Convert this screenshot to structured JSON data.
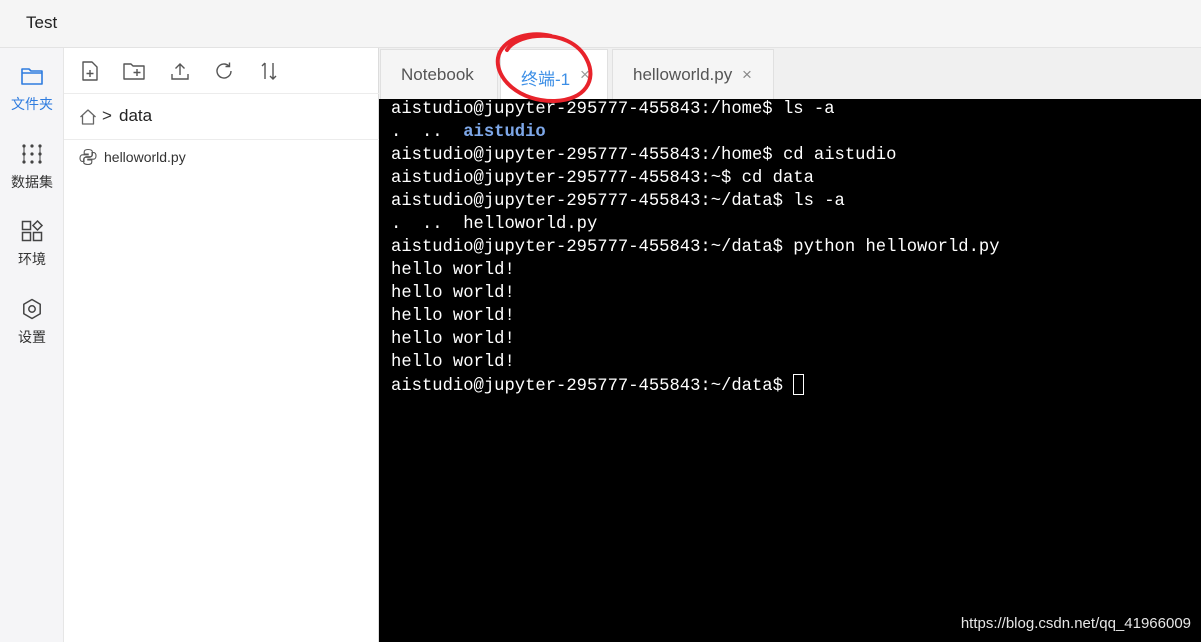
{
  "window": {
    "title": "Test"
  },
  "activity_bar": {
    "items": [
      {
        "label": "文件夹",
        "icon": "folder-icon",
        "active": true
      },
      {
        "label": "数据集",
        "icon": "dataset-icon",
        "active": false
      },
      {
        "label": "环境",
        "icon": "environment-icon",
        "active": false
      },
      {
        "label": "设置",
        "icon": "settings-icon",
        "active": false
      }
    ]
  },
  "file_toolbar": {
    "buttons": [
      "new-file-icon",
      "new-folder-icon",
      "upload-icon",
      "refresh-icon",
      "sort-icon"
    ]
  },
  "breadcrumb": {
    "separator": ">",
    "current": "data"
  },
  "files": [
    {
      "name": "helloworld.py",
      "icon": "python-icon"
    }
  ],
  "tabs": [
    {
      "label": "Notebook",
      "close": "",
      "active": false
    },
    {
      "label": "终端-1",
      "close": "×",
      "active": true
    },
    {
      "label": "helloworld.py",
      "close": "×",
      "active": false
    }
  ],
  "terminal": {
    "lines": [
      {
        "text": "aistudio@jupyter-295777-455843:/home$ ls -a"
      },
      {
        "pre": ".  ..  ",
        "dir": "aistudio"
      },
      {
        "text": "aistudio@jupyter-295777-455843:/home$ cd aistudio"
      },
      {
        "text": "aistudio@jupyter-295777-455843:~$ cd data"
      },
      {
        "text": "aistudio@jupyter-295777-455843:~/data$ ls -a"
      },
      {
        "text": ".  ..  helloworld.py"
      },
      {
        "text": "aistudio@jupyter-295777-455843:~/data$ python helloworld.py"
      },
      {
        "text": "hello world!"
      },
      {
        "text": "hello world!"
      },
      {
        "text": "hello world!"
      },
      {
        "text": "hello world!"
      },
      {
        "text": "hello world!"
      }
    ],
    "prompt": "aistudio@jupyter-295777-455843:~/data$ "
  },
  "colors": {
    "accent": "#2f7cdf",
    "active_tab_text": "#3b8ee6",
    "annotation": "#e8232b",
    "terminal_bg": "#000000",
    "dir_color": "#7da7e8"
  },
  "watermark": "https://blog.csdn.net/qq_41966009"
}
